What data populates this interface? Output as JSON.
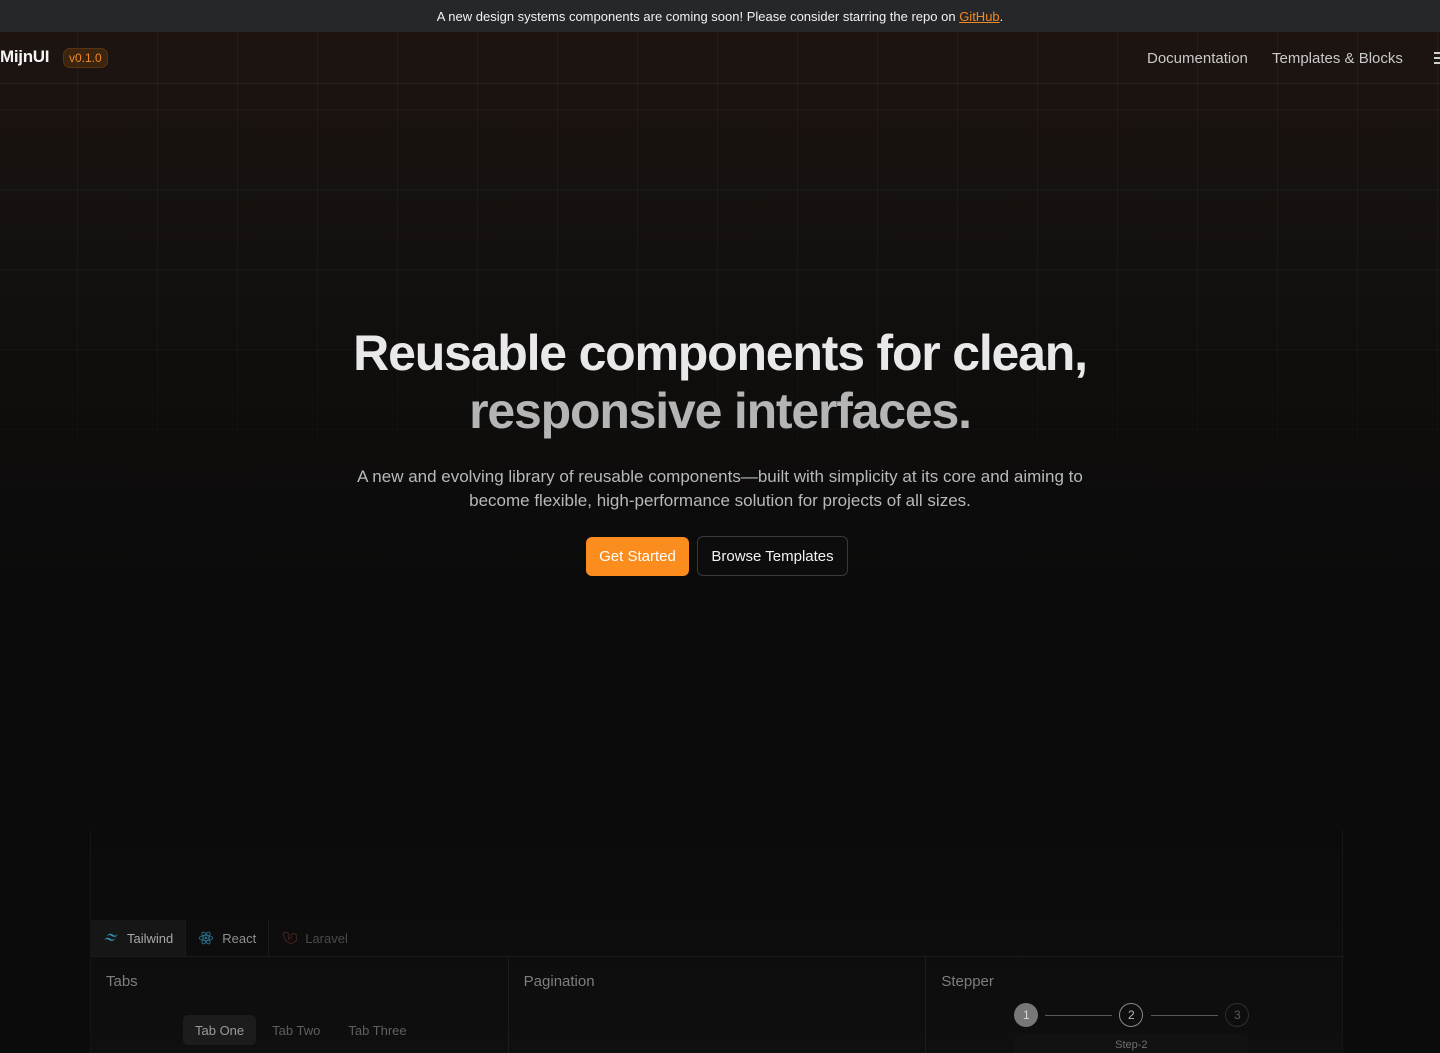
{
  "banner": {
    "text": "A new design systems components are coming soon! Please consider starring the repo on ",
    "link_label": "GitHub",
    "suffix": "."
  },
  "navbar": {
    "brand": "MijnUI",
    "version": "v0.1.0",
    "links": [
      "Documentation",
      "Templates & Blocks"
    ],
    "menu_icon": "menu-icon"
  },
  "hero": {
    "headline_line1": "Reusable components for clean,",
    "headline_line2": "responsive interfaces.",
    "subtext": "A new and evolving library of reusable components—built with simplicity at its core and aiming to become flexible, high-performance solution for projects of all sizes.",
    "primary_cta": "Get Started",
    "secondary_cta": "Browse Templates"
  },
  "showcase": {
    "framework_tabs": [
      {
        "label": "Tailwind",
        "icon": "tailwind-icon",
        "active": true
      },
      {
        "label": "React",
        "icon": "react-icon",
        "active": false
      },
      {
        "label": "Laravel",
        "icon": "laravel-icon",
        "active": false
      }
    ],
    "cards": {
      "tabs": {
        "title": "Tabs",
        "items": [
          "Tab One",
          "Tab Two",
          "Tab Three"
        ],
        "active_index": 0
      },
      "pagination": {
        "title": "Pagination"
      },
      "stepper": {
        "title": "Stepper",
        "steps": [
          "1",
          "2",
          "3"
        ],
        "current_label": "Step-2"
      }
    }
  },
  "colors": {
    "accent": "#fb8c1e",
    "banner_bg": "#26272a",
    "page_bg": "#0b0b0b"
  }
}
